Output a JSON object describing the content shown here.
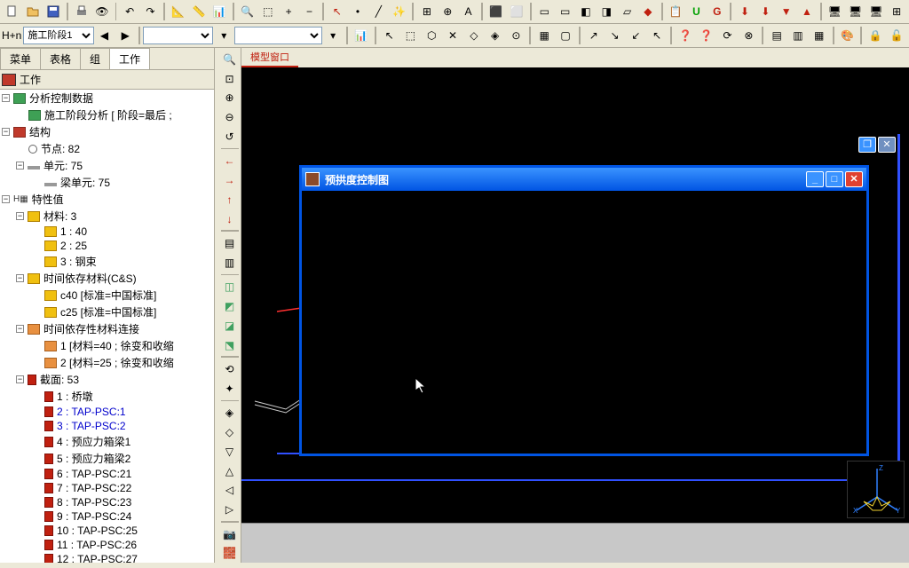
{
  "toolbars": {
    "stage_selector": "施工阶段1",
    "stage_label": "H+n"
  },
  "left_panel": {
    "tabs": [
      "菜单",
      "表格",
      "组",
      "工作"
    ],
    "active_tab": 3,
    "title": "工作",
    "tree": {
      "analysis": {
        "label": "分析控制数据",
        "stage_analysis": "施工阶段分析 [ 阶段=最后 ;"
      },
      "structure": {
        "label": "结构",
        "nodes": "节点: 82",
        "elements": "单元: 75",
        "beam_elements": "梁单元: 75"
      },
      "properties": {
        "label": "特性值",
        "materials": {
          "label": "材料: 3",
          "items": [
            "1 : 40",
            "2 : 25",
            "3 : 钢束"
          ]
        },
        "time_dep_mat": {
          "label": "时间依存材料(C&S)",
          "items": [
            "c40 [标准=中国标准]",
            "c25 [标准=中国标准]"
          ]
        },
        "time_dep_link": {
          "label": "时间依存性材料连接",
          "items": [
            "1 [材料=40 ; 徐变和收缩",
            "2 [材料=25 ; 徐变和收缩"
          ]
        },
        "sections": {
          "label": "截面: 53",
          "items": [
            {
              "t": "1 : 桥墩",
              "link": false
            },
            {
              "t": "2 : TAP-PSC:1",
              "link": true
            },
            {
              "t": "3 : TAP-PSC:2",
              "link": true
            },
            {
              "t": "4 : 预应力箱梁1",
              "link": false
            },
            {
              "t": "5 : 预应力箱梁2",
              "link": false
            },
            {
              "t": "6 : TAP-PSC:21",
              "link": false
            },
            {
              "t": "7 : TAP-PSC:22",
              "link": false
            },
            {
              "t": "8 : TAP-PSC:23",
              "link": false
            },
            {
              "t": "9 : TAP-PSC:24",
              "link": false
            },
            {
              "t": "10 : TAP-PSC:25",
              "link": false
            },
            {
              "t": "11 : TAP-PSC:26",
              "link": false
            },
            {
              "t": "12 : TAP-PSC:27",
              "link": false
            }
          ]
        }
      }
    }
  },
  "viewport": {
    "tab": "模型窗口",
    "child_window_title": "预拱度控制图"
  }
}
